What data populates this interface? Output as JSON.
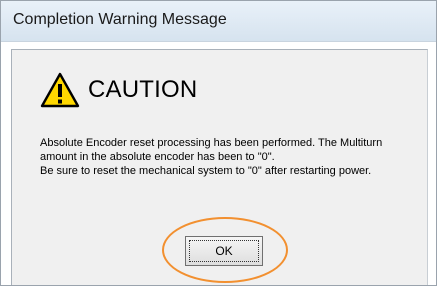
{
  "window": {
    "title": "Completion Warning Message"
  },
  "caution": {
    "icon": "warning-triangle-icon",
    "heading": "CAUTION"
  },
  "message": {
    "paragraph1": "Absolute Encoder reset processing has been performed. The Multiturn amount in the absolute encoder has been to \"0\".",
    "paragraph2": "Be sure to reset the mechanical system to \"0\" after restarting power."
  },
  "buttons": {
    "ok_label": "OK"
  },
  "colors": {
    "highlight_ring": "#f29030",
    "warning_yellow": "#ffd800"
  }
}
